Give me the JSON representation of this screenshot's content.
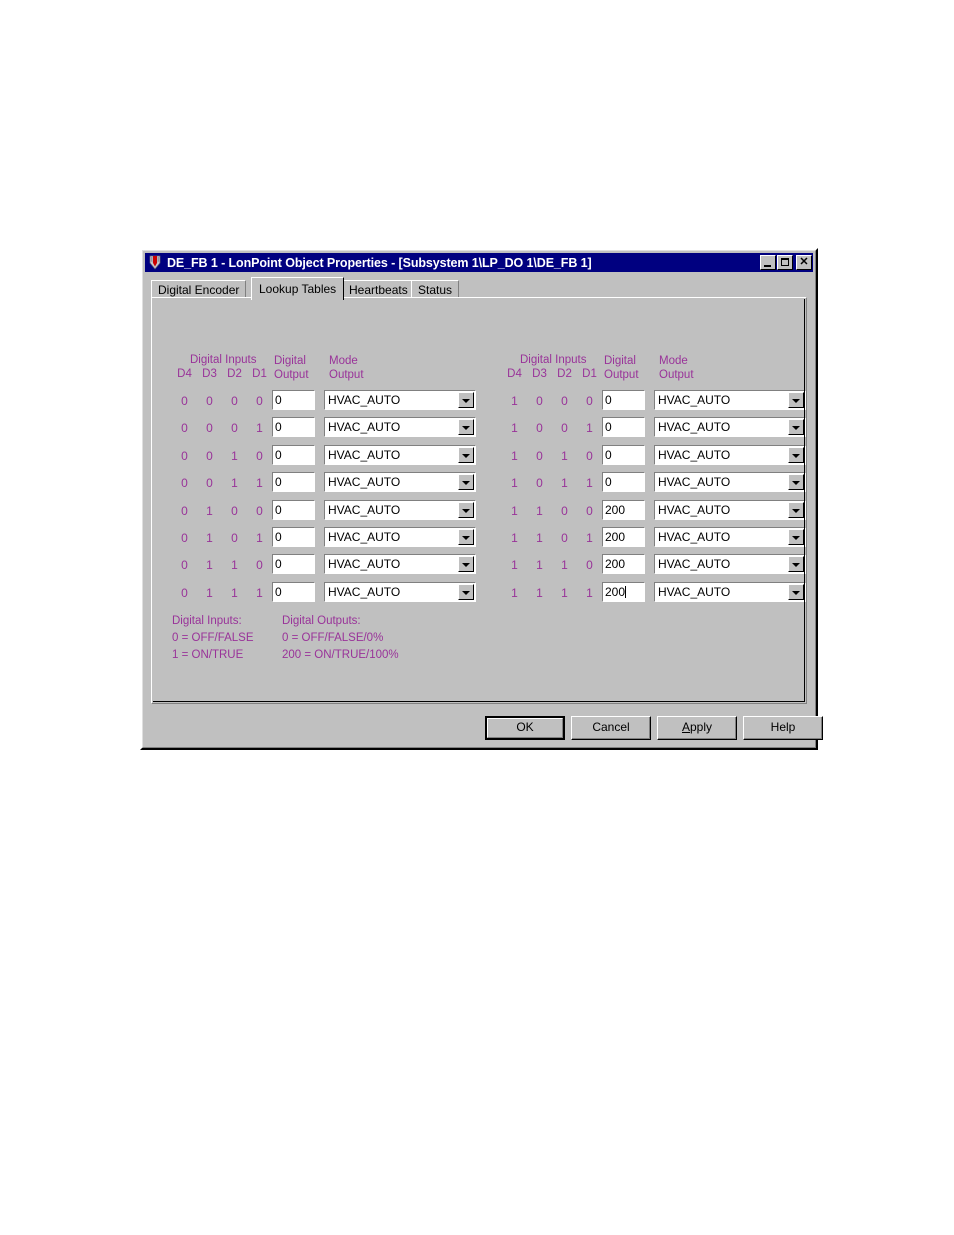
{
  "window": {
    "title": "DE_FB 1 - LonPoint Object Properties - [Subsystem 1\\LP_DO 1\\DE_FB 1]",
    "icon": "lonpoint-shield-icon",
    "minimize_label": "",
    "maximize_label": "",
    "close_label": "✕",
    "titlebar_color": "#000080",
    "face_color": "#c0c0c0",
    "accent_color": "#993399"
  },
  "tabs": [
    {
      "label": "Digital Encoder",
      "active": false
    },
    {
      "label": "Lookup Tables",
      "active": true
    },
    {
      "label": "Heartbeats",
      "active": false
    },
    {
      "label": "Status",
      "active": false
    }
  ],
  "tables": [
    {
      "id": "lookup-table-left",
      "headers": {
        "digital_inputs": "Digital Inputs",
        "bits": [
          "D4",
          "D3",
          "D2",
          "D1"
        ],
        "digital_output_l1": "Digital",
        "digital_output_l2": "Output",
        "mode_output_l1": "Mode",
        "mode_output_l2": "Output"
      },
      "rows": [
        {
          "bits": [
            "0",
            "0",
            "0",
            "0"
          ],
          "digital_output": "0",
          "mode_output": "HVAC_AUTO",
          "caret": false
        },
        {
          "bits": [
            "0",
            "0",
            "0",
            "1"
          ],
          "digital_output": "0",
          "mode_output": "HVAC_AUTO",
          "caret": false
        },
        {
          "bits": [
            "0",
            "0",
            "1",
            "0"
          ],
          "digital_output": "0",
          "mode_output": "HVAC_AUTO",
          "caret": false
        },
        {
          "bits": [
            "0",
            "0",
            "1",
            "1"
          ],
          "digital_output": "0",
          "mode_output": "HVAC_AUTO",
          "caret": false
        },
        {
          "bits": [
            "0",
            "1",
            "0",
            "0"
          ],
          "digital_output": "0",
          "mode_output": "HVAC_AUTO",
          "caret": false
        },
        {
          "bits": [
            "0",
            "1",
            "0",
            "1"
          ],
          "digital_output": "0",
          "mode_output": "HVAC_AUTO",
          "caret": false
        },
        {
          "bits": [
            "0",
            "1",
            "1",
            "0"
          ],
          "digital_output": "0",
          "mode_output": "HVAC_AUTO",
          "caret": false
        },
        {
          "bits": [
            "0",
            "1",
            "1",
            "1"
          ],
          "digital_output": "0",
          "mode_output": "HVAC_AUTO",
          "caret": false
        }
      ]
    },
    {
      "id": "lookup-table-right",
      "headers": {
        "digital_inputs": "Digital Inputs",
        "bits": [
          "D4",
          "D3",
          "D2",
          "D1"
        ],
        "digital_output_l1": "Digital",
        "digital_output_l2": "Output",
        "mode_output_l1": "Mode",
        "mode_output_l2": "Output"
      },
      "rows": [
        {
          "bits": [
            "1",
            "0",
            "0",
            "0"
          ],
          "digital_output": "0",
          "mode_output": "HVAC_AUTO",
          "caret": false
        },
        {
          "bits": [
            "1",
            "0",
            "0",
            "1"
          ],
          "digital_output": "0",
          "mode_output": "HVAC_AUTO",
          "caret": false
        },
        {
          "bits": [
            "1",
            "0",
            "1",
            "0"
          ],
          "digital_output": "0",
          "mode_output": "HVAC_AUTO",
          "caret": false
        },
        {
          "bits": [
            "1",
            "0",
            "1",
            "1"
          ],
          "digital_output": "0",
          "mode_output": "HVAC_AUTO",
          "caret": false
        },
        {
          "bits": [
            "1",
            "1",
            "0",
            "0"
          ],
          "digital_output": "200",
          "mode_output": "HVAC_AUTO",
          "caret": false
        },
        {
          "bits": [
            "1",
            "1",
            "0",
            "1"
          ],
          "digital_output": "200",
          "mode_output": "HVAC_AUTO",
          "caret": false
        },
        {
          "bits": [
            "1",
            "1",
            "1",
            "0"
          ],
          "digital_output": "200",
          "mode_output": "HVAC_AUTO",
          "caret": false
        },
        {
          "bits": [
            "1",
            "1",
            "1",
            "1"
          ],
          "digital_output": "200",
          "mode_output": "HVAC_AUTO",
          "caret": true
        }
      ]
    }
  ],
  "legend": {
    "inputs_title": "Digital Inputs:",
    "inputs_lines": [
      "0 = OFF/FALSE",
      "1 = ON/TRUE"
    ],
    "outputs_title": "Digital Outputs:",
    "outputs_lines": [
      "0 = OFF/FALSE/0%",
      "200 = ON/TRUE/100%"
    ]
  },
  "buttons": {
    "ok": "OK",
    "cancel": "Cancel",
    "apply_pre": "",
    "apply_accel": "A",
    "apply_post": "pply",
    "help": "Help"
  }
}
